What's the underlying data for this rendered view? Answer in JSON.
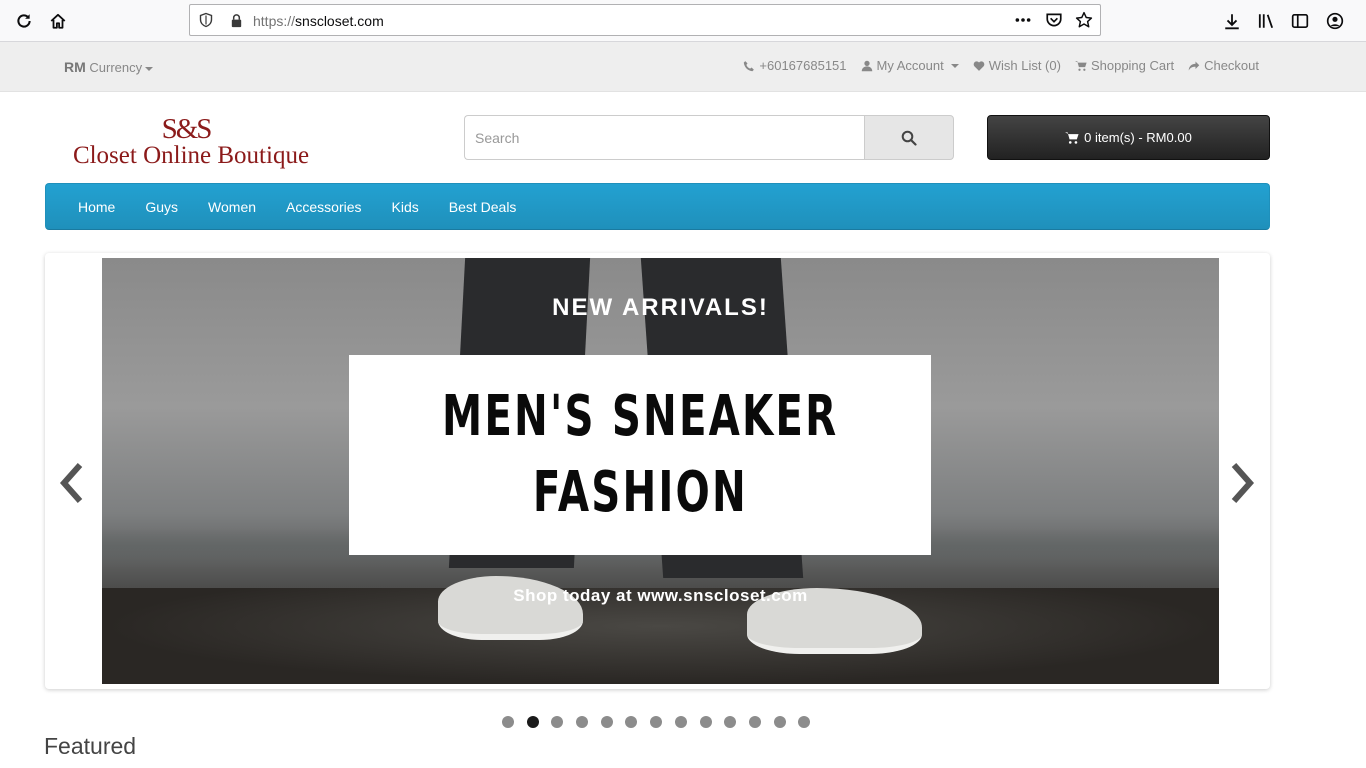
{
  "browser": {
    "url_protocol": "https://",
    "url_host": "snscloset.com",
    "url_full": "https://snscloset.com",
    "icons": [
      "reload-icon",
      "home-icon",
      "shield-icon",
      "lock-icon",
      "more-icon",
      "pocket-icon",
      "star-icon",
      "download-icon",
      "library-icon",
      "sidebar-icon",
      "account-icon"
    ]
  },
  "topbar": {
    "currency_symbol": "RM",
    "currency_label": "Currency",
    "phone": "+60167685151",
    "my_account": "My Account",
    "wish_list": "Wish List (0)",
    "shopping_cart": "Shopping Cart",
    "checkout": "Checkout"
  },
  "header": {
    "logo_mark": "S&S",
    "logo_name": "Closet Online Boutique",
    "search_placeholder": "Search",
    "cart_button": "0 item(s) - RM0.00"
  },
  "menu": {
    "items": [
      "Home",
      "Guys",
      "Women",
      "Accessories",
      "Kids",
      "Best Deals"
    ]
  },
  "slideshow": {
    "headline": "NEW ARRIVALS!",
    "banner_line1": "MEN'S SNEAKER",
    "banner_line2": "FASHION",
    "tagline": "Shop today at www.snscloset.com",
    "total_slides": 13,
    "active_slide": 2
  },
  "featured": {
    "heading": "Featured"
  },
  "colors": {
    "menu_blue": "#229ac8",
    "logo_red": "#8b1a1a",
    "cart_dark": "#333333"
  }
}
